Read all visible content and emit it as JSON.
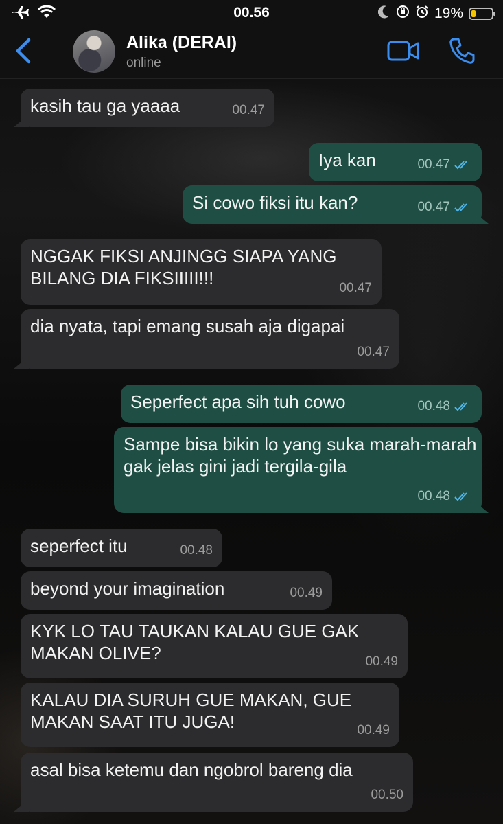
{
  "status_bar": {
    "time": "00.56",
    "battery": "19%",
    "icons": [
      "airplane-icon",
      "wifi-icon",
      "moon-icon",
      "rotation-lock-icon",
      "alarm-icon",
      "battery-icon"
    ]
  },
  "header": {
    "contact_name": "Alika (DERAI)",
    "contact_status": "online",
    "icons": [
      "back-chevron-icon",
      "video-call-icon",
      "phone-call-icon"
    ]
  },
  "messages": [
    {
      "direction": "in",
      "text": "kasih tau ga yaaaa",
      "time": "00.47"
    },
    {
      "direction": "out",
      "text": "Iya kan",
      "time": "00.47"
    },
    {
      "direction": "out",
      "text": "Si cowo fiksi itu kan?",
      "time": "00.47"
    },
    {
      "direction": "in",
      "text": "NGGAK FIKSI ANJINGG SIAPA YANG BILANG DIA FIKSIIIII!!!",
      "time": "00.47"
    },
    {
      "direction": "in",
      "text": "dia nyata, tapi emang susah aja digapai",
      "time": "00.47"
    },
    {
      "direction": "out",
      "text": "Seperfect apa sih tuh cowo",
      "time": "00.48"
    },
    {
      "direction": "out",
      "text": "Sampe bisa bikin lo yang suka marah-marah gak jelas gini jadi tergila-gila",
      "time": "00.48"
    },
    {
      "direction": "in",
      "text": "seperfect itu",
      "time": "00.48"
    },
    {
      "direction": "in",
      "text": "beyond your imagination",
      "time": "00.49"
    },
    {
      "direction": "in",
      "text": "KYK LO TAU TAUKAN KALAU GUE GAK MAKAN OLIVE?",
      "time": "00.49"
    },
    {
      "direction": "in",
      "text": "KALAU DIA SURUH GUE MAKAN, GUE MAKAN SAAT ITU JUGA!",
      "time": "00.49"
    },
    {
      "direction": "in",
      "text": "asal bisa ketemu dan ngobrol bareng dia",
      "time": "00.50"
    }
  ],
  "colors": {
    "incoming_bubble": "#2c2c2e",
    "outgoing_bubble": "#1f4f44",
    "accent_blue": "#3b8df0",
    "read_tick": "#4fb6ec"
  }
}
